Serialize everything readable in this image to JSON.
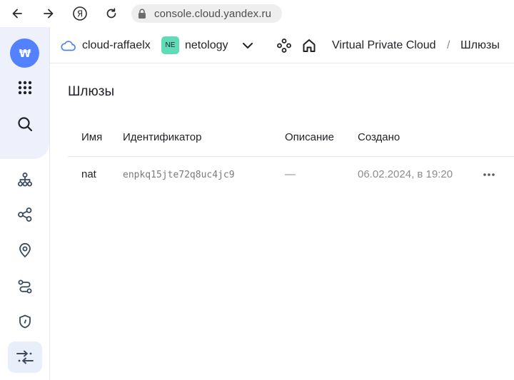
{
  "browser": {
    "url": "console.cloud.yandex.ru",
    "icons": [
      "back-arrow-icon",
      "forward-arrow-icon",
      "yandex-icon",
      "reload-icon",
      "lock-icon"
    ]
  },
  "sidebar": {
    "items": [
      {
        "name": "all-services",
        "icon": "grid-dots-icon"
      },
      {
        "name": "search",
        "icon": "search-icon"
      },
      {
        "name": "cloud-networks",
        "icon": "network-icon"
      },
      {
        "name": "routing",
        "icon": "share-nodes-icon"
      },
      {
        "name": "ip-addresses",
        "icon": "location-pin-icon"
      },
      {
        "name": "route-tables",
        "icon": "route-icon"
      },
      {
        "name": "security-groups",
        "icon": "shield-icon"
      },
      {
        "name": "gateways",
        "icon": "gateway-arrows-icon",
        "active": true
      }
    ]
  },
  "header": {
    "cloud_name": "cloud-raffaelx",
    "folder_badge": "NE",
    "folder_name": "netology",
    "service": "Virtual Private Cloud",
    "separator": "/",
    "current": "Шлюзы"
  },
  "page": {
    "title": "Шлюзы"
  },
  "table": {
    "columns": [
      "Имя",
      "Идентификатор",
      "Описание",
      "Создано"
    ],
    "rows": [
      {
        "name": "nat",
        "id": "enpkq15jte72q8uc4jc9",
        "description": "—",
        "created": "06.02.2024, в 19:20"
      }
    ]
  },
  "colors": {
    "accent": "#5282ff",
    "folder_badge": "#5fdbb8",
    "sidebar_bg": "#eef1fb"
  }
}
